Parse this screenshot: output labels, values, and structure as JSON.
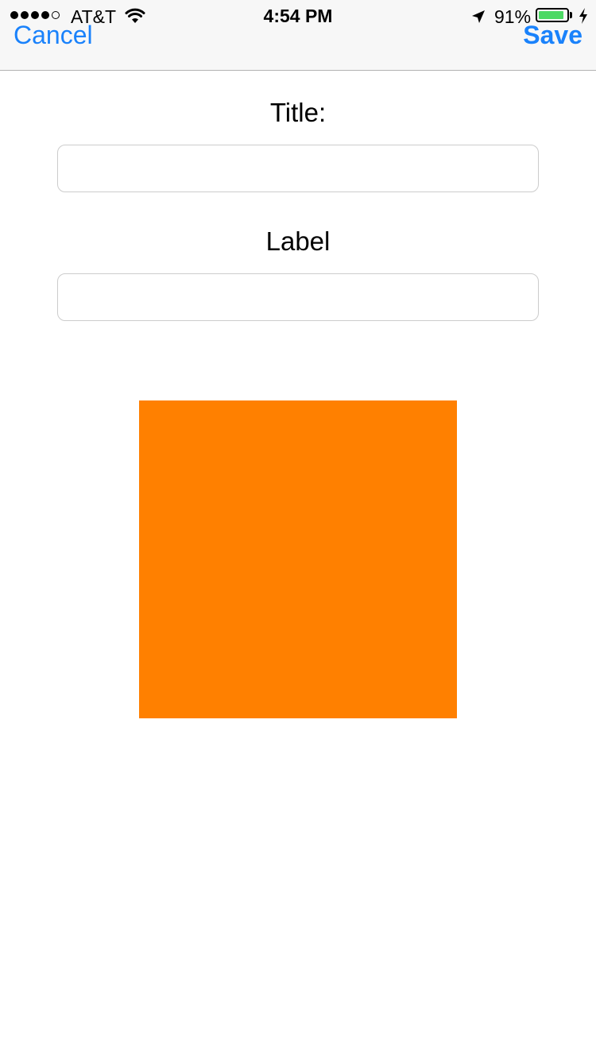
{
  "status_bar": {
    "signal_bars": 4,
    "signal_max": 5,
    "carrier": "AT&T",
    "time": "4:54 PM",
    "battery_percent": "91%",
    "battery_level": 0.91,
    "charging": true,
    "icons": [
      "wifi-icon",
      "location-arrow-icon",
      "battery-icon",
      "charging-bolt-icon"
    ]
  },
  "nav": {
    "cancel_label": "Cancel",
    "save_label": "Save",
    "tint_color": "#1a82fb"
  },
  "form": {
    "title_label": "Title:",
    "title_value": "",
    "label_label": "Label",
    "label_value": ""
  },
  "swatch": {
    "color": "#ff8000"
  }
}
